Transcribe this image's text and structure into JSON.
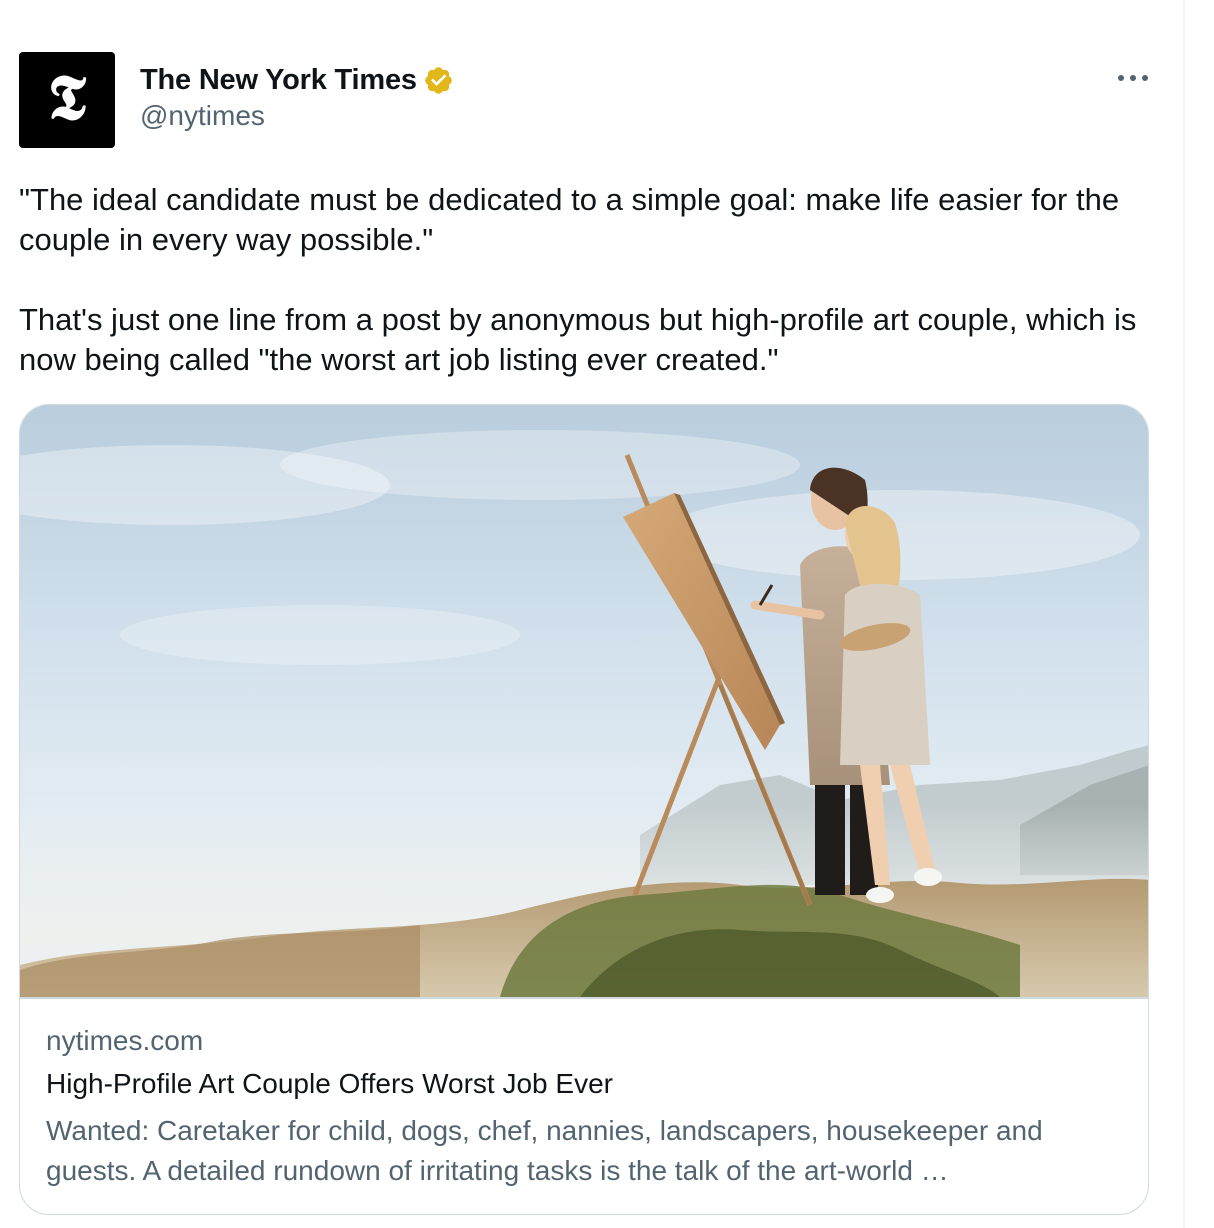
{
  "author": {
    "name": "The New York Times",
    "handle": "@nytimes",
    "avatar_glyph": "𝕿",
    "avatar_icon": "nyt-t-logo",
    "verified_icon": "verified-gold-badge",
    "verified_color": "#e2b719"
  },
  "tweet": {
    "text": "\"The ideal candidate must be dedicated to a simple goal: make life easier for the couple in every way possible.\"\n\nThat's just one line from a post by anonymous but high-profile art couple, which is now being called \"the worst art job listing ever created.\""
  },
  "card": {
    "image_description_icon": "couple-painting-at-easel-photo",
    "domain": "nytimes.com",
    "title": "High-Profile Art Couple Offers Worst Job Ever",
    "description": "Wanted: Caretaker for child, dogs, chef, nannies, landscapers, housekeeper and guests. A detailed rundown of irritating tasks is the talk of the art-world …"
  },
  "more_icon": "more-horizontal-icon",
  "colors": {
    "text_primary": "#0f1419",
    "text_secondary": "#536471",
    "border": "#cfd9de"
  }
}
